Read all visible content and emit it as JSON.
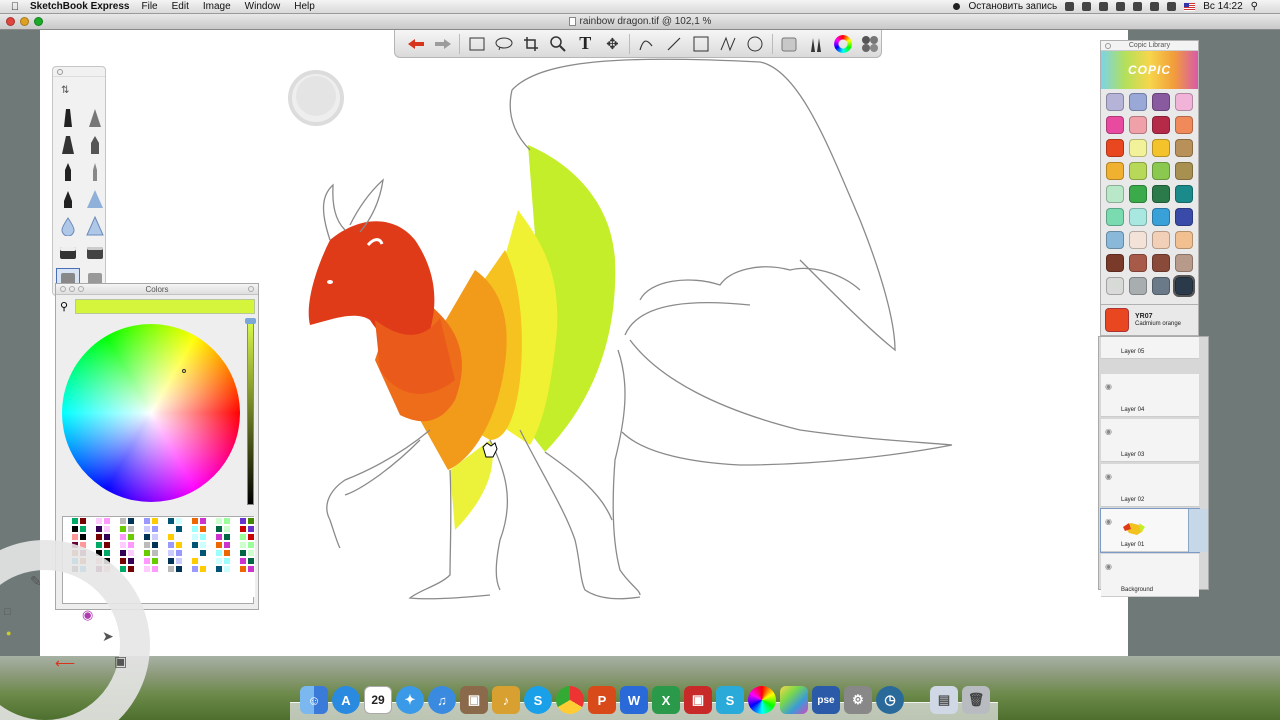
{
  "menubar": {
    "app_name": "SketchBook Express",
    "items": [
      "File",
      "Edit",
      "Image",
      "Window",
      "Help"
    ],
    "recording_status": "Остановить запись",
    "clock": "Вс 14:22"
  },
  "window": {
    "title": "rainbow dragon.tif @ 102,1 %"
  },
  "toolbar": {
    "tools": [
      "undo-icon",
      "redo-icon",
      "rectangle-select-icon",
      "lasso-icon",
      "crop-icon",
      "zoom-icon",
      "text-icon",
      "move-icon",
      "pencil-icon",
      "line-icon",
      "rect-icon",
      "polyline-icon",
      "ellipse-icon",
      "brush-palette-icon",
      "brushes-icon",
      "color-wheel-icon",
      "copic-icon"
    ]
  },
  "colors_panel": {
    "title": "Colors",
    "current_color": "#d4f53b"
  },
  "copic_library": {
    "title": "Copic Library",
    "brand": "COPIC",
    "selected_code": "YR07",
    "selected_name": "Cadmium orange",
    "selected_color": "#e8471f",
    "swatches": [
      "#b6b3d9",
      "#9aa8d8",
      "#8a5aa0",
      "#f1b4d8",
      "#e84aa0",
      "#f0a0a8",
      "#b52a48",
      "#f08a5a",
      "#e8471f",
      "#f2f29a",
      "#f4c22a",
      "#b8905a",
      "#f0b030",
      "#b8d85a",
      "#8ac850",
      "#a89050",
      "#b8e8c8",
      "#3aaa4a",
      "#2a7a4a",
      "#1a8a8a",
      "#7adab0",
      "#a8e8e0",
      "#3aa0d8",
      "#3a4aa8",
      "#8ab8d8",
      "#f2e2d8",
      "#f2d0b8",
      "#f2c090",
      "#7a3a2a",
      "#a85a48",
      "#8a4a3a",
      "#b89a8a",
      "#d8dad8",
      "#a8aeb0",
      "#6a7a88",
      "#2a3a4a"
    ]
  },
  "layers": [
    {
      "name": "Layer 05",
      "active": false
    },
    {
      "name": "Layer 04",
      "active": false
    },
    {
      "name": "Layer 03",
      "active": false
    },
    {
      "name": "Layer 02",
      "active": false
    },
    {
      "name": "Layer 01",
      "active": true
    },
    {
      "name": "Background",
      "active": false
    }
  ],
  "dock": {
    "apps": [
      "finder-icon",
      "app-store-icon",
      "calendar-icon",
      "safari-icon",
      "itunes-icon",
      "preview-icon",
      "garageband-icon",
      "skype-icon",
      "chrome-icon",
      "powerpoint-icon",
      "word-icon",
      "excel-icon",
      "photobooth-icon",
      "sketchbook-icon",
      "color-picker-icon",
      "photos-icon",
      "pse-icon",
      "preferences-icon",
      "time-machine-icon",
      "files-icon",
      "trash-icon"
    ],
    "calendar_day": "29",
    "pse_label": "pse"
  }
}
